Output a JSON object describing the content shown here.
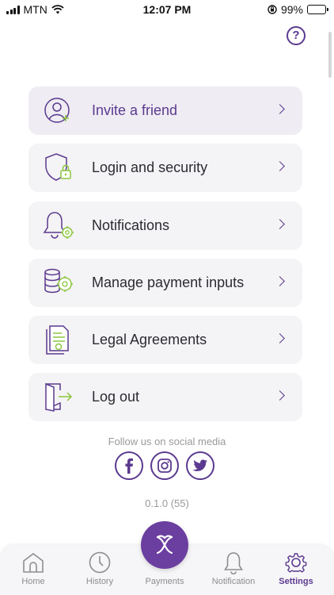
{
  "status_bar": {
    "carrier": "MTN",
    "time": "12:07 PM",
    "battery": "99%"
  },
  "help_icon": "question-mark-icon",
  "menu": [
    {
      "label": "Invite a friend",
      "icon": "invite-friend-icon"
    },
    {
      "label": "Login and security",
      "icon": "shield-lock-icon"
    },
    {
      "label": "Notifications",
      "icon": "bell-gear-icon"
    },
    {
      "label": "Manage payment inputs",
      "icon": "database-gear-icon"
    },
    {
      "label": "Legal Agreements",
      "icon": "document-icon"
    },
    {
      "label": "Log out",
      "icon": "logout-icon"
    }
  ],
  "social": {
    "caption": "Follow us on social media",
    "networks": [
      "facebook-icon",
      "instagram-icon",
      "twitter-icon"
    ]
  },
  "version": "0.1.0 (55)",
  "tabs": [
    {
      "label": "Home",
      "icon": "home-icon"
    },
    {
      "label": "History",
      "icon": "clock-icon"
    },
    {
      "label": "Payments",
      "icon": "payments-icon"
    },
    {
      "label": "Notification",
      "icon": "bell-icon"
    },
    {
      "label": "Settings",
      "icon": "gear-icon"
    }
  ],
  "selected_tab": "Settings",
  "colors": {
    "accent": "#5b3a8f",
    "accent_green": "#8cc63f",
    "fab": "#6b3fa0",
    "card_bg": "#f4f3f5"
  }
}
